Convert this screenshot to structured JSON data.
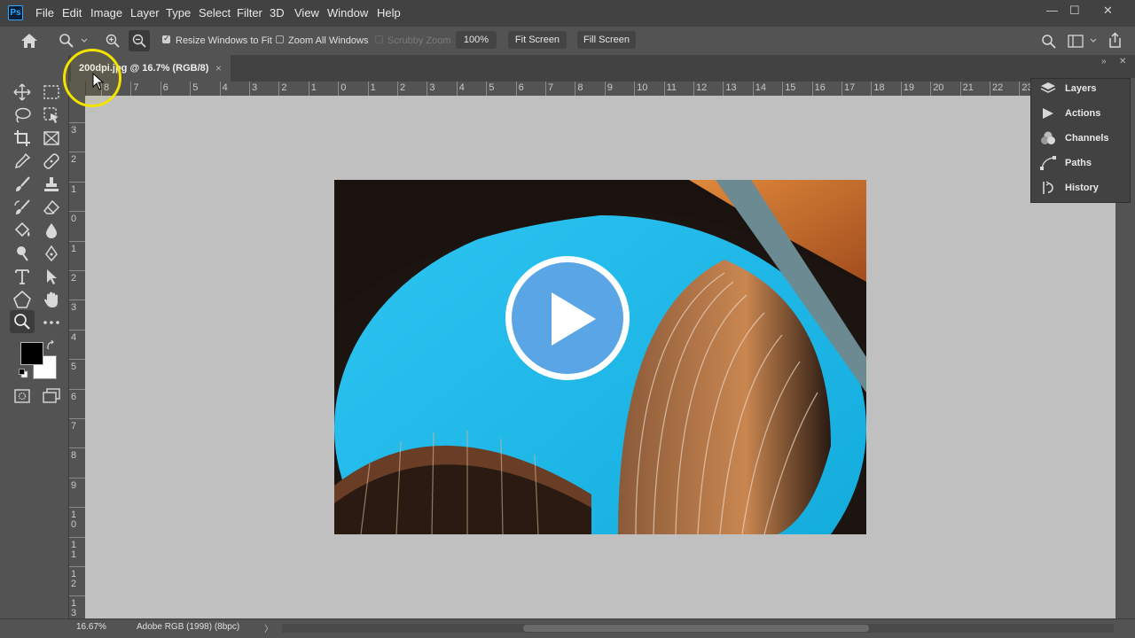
{
  "app": {
    "logo": "Ps"
  },
  "menu": [
    "File",
    "Edit",
    "Image",
    "Layer",
    "Type",
    "Select",
    "Filter",
    "3D",
    "View",
    "Window",
    "Help"
  ],
  "window_controls": {
    "minimize": "—",
    "maximize": "☐",
    "close": "✕"
  },
  "options": {
    "resize_windows_label": "Resize Windows to Fit",
    "resize_windows_checked": true,
    "zoom_all_label": "Zoom All Windows",
    "zoom_all_checked": false,
    "scrubby_zoom_label": "Scrubby Zoom",
    "zoom_value": "100%",
    "fit_screen": "Fit Screen",
    "fill_screen": "Fill Screen"
  },
  "document_tab": {
    "title": "200dpi.jpg @ 16.7% (RGB/8)",
    "close": "×"
  },
  "ruler_h": [
    "8",
    "7",
    "6",
    "5",
    "4",
    "3",
    "2",
    "1",
    "0",
    "1",
    "2",
    "3",
    "4",
    "5",
    "6",
    "7",
    "8",
    "9",
    "10",
    "11",
    "12",
    "13",
    "14",
    "15",
    "16",
    "17",
    "18",
    "19",
    "20",
    "21",
    "22",
    "23"
  ],
  "ruler_v": [
    "3",
    "2",
    "1",
    "0",
    "1",
    "2",
    "3",
    "4",
    "5",
    "6",
    "7",
    "8",
    "9",
    "1 0",
    "1 1",
    "1 2",
    "1 3"
  ],
  "panels": [
    {
      "label": "Layers",
      "icon": "layers-icon"
    },
    {
      "label": "Actions",
      "icon": "play-icon"
    },
    {
      "label": "Channels",
      "icon": "channels-icon"
    },
    {
      "label": "Paths",
      "icon": "pen-path-icon"
    },
    {
      "label": "History",
      "icon": "history-icon"
    }
  ],
  "status": {
    "zoom": "16.67%",
    "profile": "Adobe RGB (1998) (8bpc)",
    "arrow": "〉"
  },
  "colors": {
    "accent": "#31a8ff",
    "play_button": "#5aa5e6",
    "highlight_ring": "#f0e400"
  }
}
